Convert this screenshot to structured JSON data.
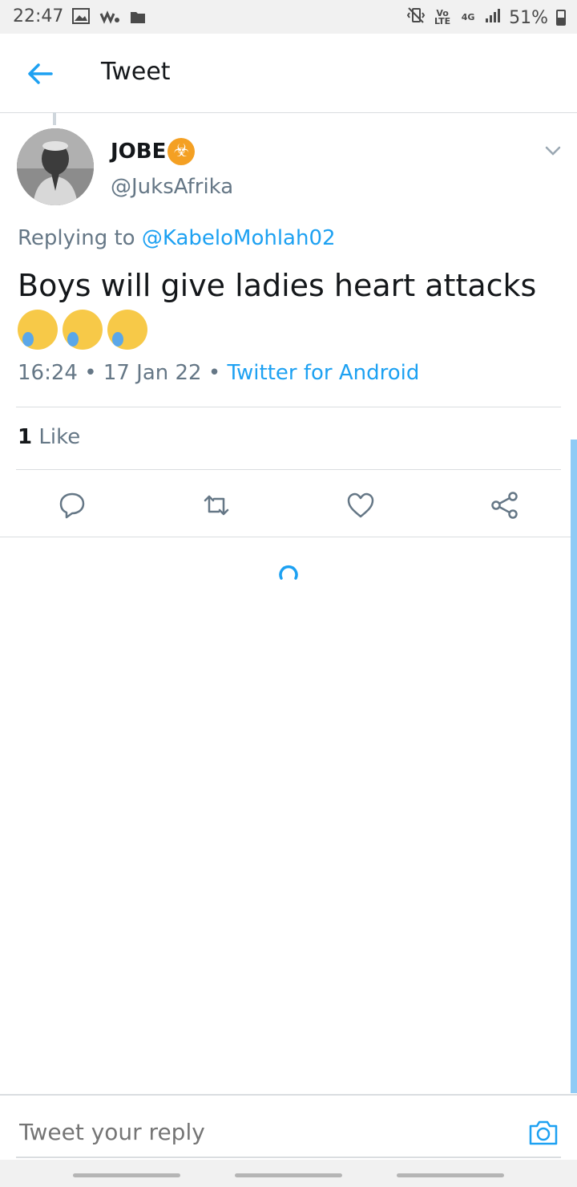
{
  "status_bar": {
    "time": "22:47",
    "battery": "51%",
    "network": "4G",
    "volte": "Vo LTE",
    "battery_level": 0.51
  },
  "header": {
    "title": "Tweet",
    "back_icon": "arrow-left-icon"
  },
  "tweet": {
    "display_name": "JOBE",
    "name_badge_icon": "biohazard-icon",
    "handle": "@JuksAfrika",
    "replying_prefix": "Replying to",
    "replying_to": "@KabeloMohlah02",
    "text": "Boys will give ladies heart attacks",
    "emojis": [
      "rolling-on-floor-laughing",
      "rolling-on-floor-laughing",
      "rolling-on-floor-laughing"
    ],
    "time": "16:24",
    "date": "17 Jan 22",
    "separator": "•",
    "source": "Twitter for Android",
    "like_count": "1",
    "like_label": "Like"
  },
  "actions": [
    "reply-icon",
    "retweet-icon",
    "like-icon",
    "share-icon"
  ],
  "reply_bar": {
    "placeholder": "Tweet your reply",
    "camera_icon": "camera-icon"
  },
  "colors": {
    "accent": "#1da1f2",
    "secondary_text": "#657786",
    "primary_text": "#14171a"
  }
}
